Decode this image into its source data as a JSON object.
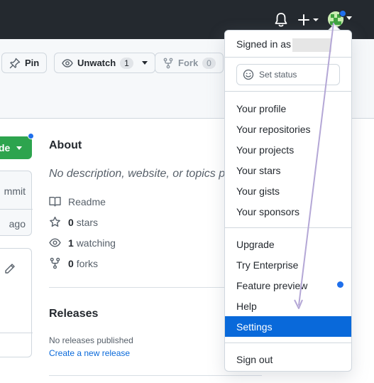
{
  "topbar": {
    "icons": [
      "bell-icon",
      "plus-icon",
      "avatar"
    ]
  },
  "repo_actions": {
    "pin_label": "Pin",
    "unwatch_label": "Unwatch",
    "unwatch_count": "1",
    "fork_label": "Fork",
    "fork_count": "0"
  },
  "code_button": {
    "label": "de"
  },
  "commit_panel": {
    "line1": "mmit",
    "line2": "ago"
  },
  "about": {
    "title": "About",
    "description": "No description, website, or topics pro",
    "readme": "Readme",
    "stars_count": "0",
    "stars_label": "stars",
    "watching_count": "1",
    "watching_label": "watching",
    "forks_count": "0",
    "forks_label": "forks"
  },
  "releases": {
    "title": "Releases",
    "empty_text": "No releases published",
    "create_link": "Create a new release"
  },
  "user_menu": {
    "signed_in_as": "Signed in as",
    "set_status": "Set status",
    "items_profile": [
      "Your profile",
      "Your repositories",
      "Your projects",
      "Your stars",
      "Your gists",
      "Your sponsors"
    ],
    "items_misc": [
      "Upgrade",
      "Try Enterprise",
      "Feature preview",
      "Help",
      "Settings"
    ],
    "sign_out": "Sign out",
    "selected": "Settings"
  },
  "colors": {
    "header_bg": "#24292f",
    "accent_blue": "#0969da",
    "notification_blue": "#1f6feb",
    "green_button": "#2da44e",
    "pointer_annotation": "#b4a7d6"
  }
}
